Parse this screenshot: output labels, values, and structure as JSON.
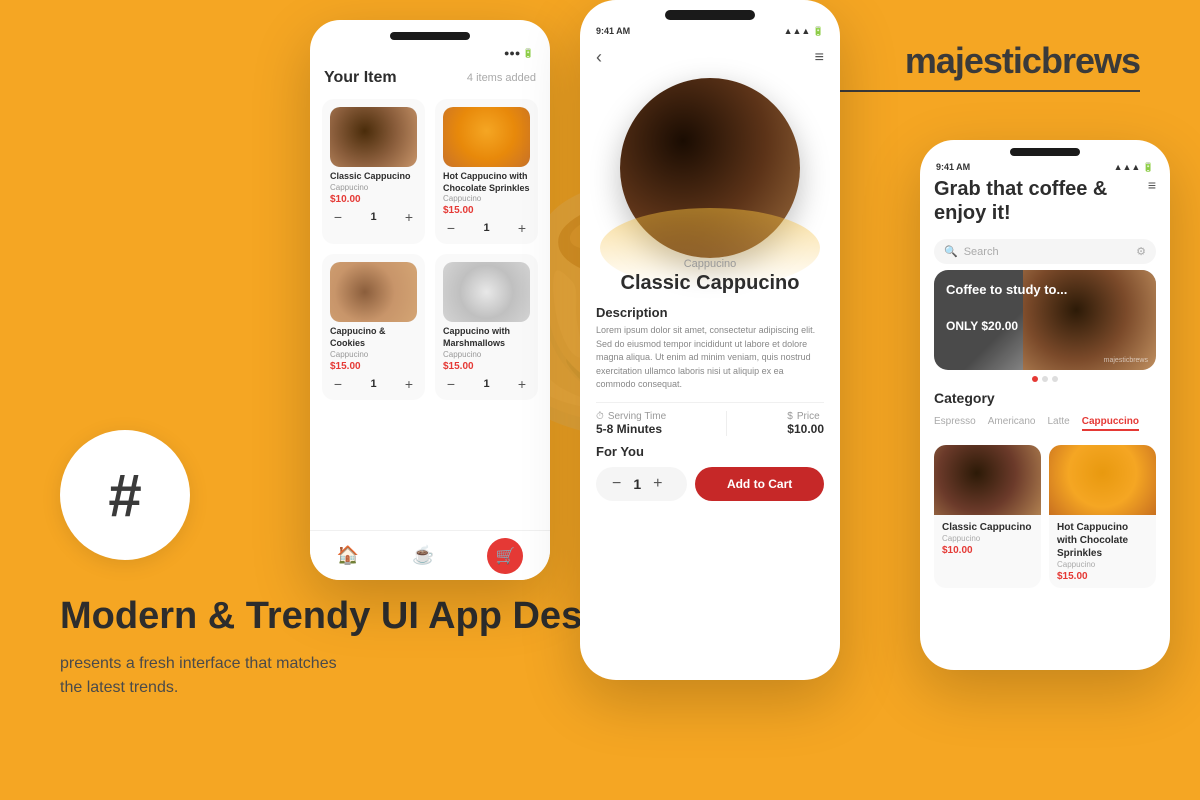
{
  "brand": {
    "name": "majesticbrews",
    "tagline": "majesticbrews"
  },
  "page": {
    "title": "Modern & Trendy UI App Design",
    "subtitle": "presents a fresh interface that matches the latest trends."
  },
  "phone1": {
    "header": "Your Item",
    "items_count": "4 items added",
    "items": [
      {
        "name": "Classic Cappucino",
        "category": "Cappucino",
        "price": "$10.00",
        "qty": "1"
      },
      {
        "name": "Hot Cappucino with Chocolate Sprinkles",
        "category": "Cappucino",
        "price": "$15.00",
        "qty": "1"
      },
      {
        "name": "Cappucino & Cookies",
        "category": "Cappucino",
        "price": "$15.00",
        "qty": "1"
      },
      {
        "name": "Cappucino with Marshmallows",
        "category": "Cappucino",
        "price": "$15.00",
        "qty": "1"
      }
    ]
  },
  "phone2": {
    "time": "9:41 AM",
    "category": "Cappucino",
    "title": "Classic Cappucino",
    "desc_title": "Description",
    "desc_text": "Lorem ipsum dolor sit amet, consectetur adipiscing elit. Sed do eiusmod tempor incididunt ut labore et dolore magna aliqua. Ut enim ad minim veniam, quis nostrud exercitation ullamco laboris nisi ut aliquip ex ea commodo consequat.",
    "serving_label": "Serving Time",
    "serving_value": "5-8 Minutes",
    "price_label": "Price",
    "price_value": "$10.00",
    "for_you": "For You",
    "qty": "1",
    "add_to_cart": "Add to Cart"
  },
  "phone3": {
    "time": "9:41 AM",
    "greeting": "Grab that coffee & enjoy it!",
    "search_placeholder": "Search",
    "promo": {
      "title": "Coffee to study to...",
      "price": "ONLY $20.00",
      "brand_watermark": "majesticbrews"
    },
    "category_title": "Category",
    "categories": [
      "Espresso",
      "Americano",
      "Latte",
      "Cappuccino"
    ],
    "active_category": "Cappuccino",
    "products": [
      {
        "name": "Classic Cappucino",
        "category": "Cappucino",
        "price": "$10.00"
      },
      {
        "name": "Hot Cappucino with Chocolate Sprinkles",
        "category": "Cappucino",
        "price": "$15.00"
      }
    ]
  }
}
